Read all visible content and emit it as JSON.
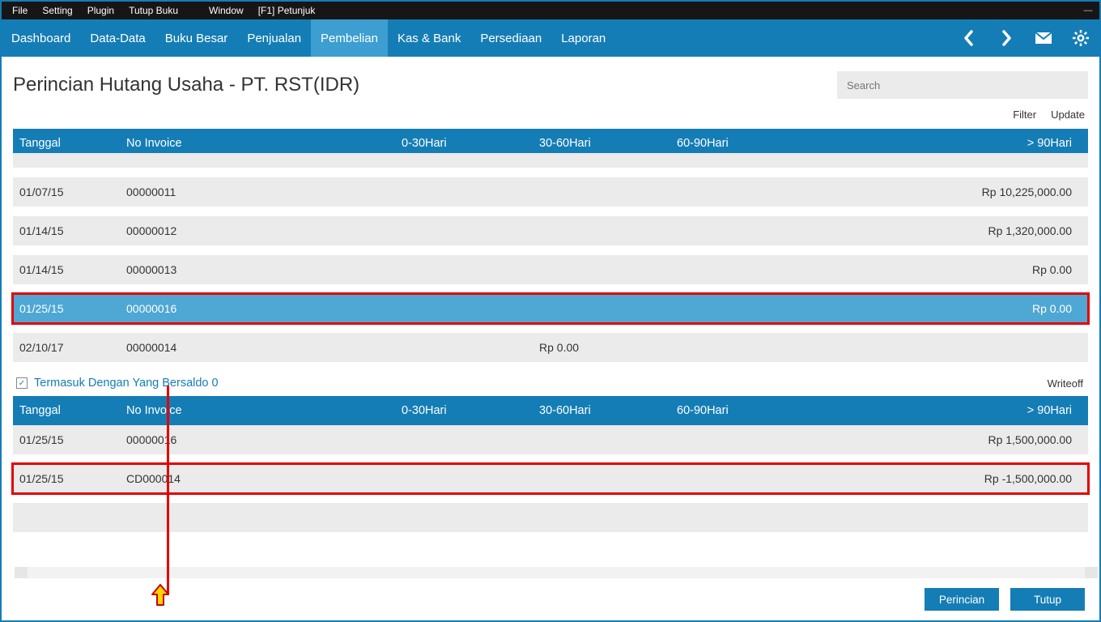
{
  "menubar": [
    "File",
    "Setting",
    "Plugin",
    "Tutup Buku",
    "",
    "Window",
    "[F1] Petunjuk"
  ],
  "nav": {
    "items": [
      "Dashboard",
      "Data-Data",
      "Buku Besar",
      "Penjualan",
      "Pembelian",
      "Kas & Bank",
      "Persediaan",
      "Laporan"
    ],
    "active_index": 4
  },
  "page": {
    "title": "Perincian Hutang Usaha - PT. RST(IDR)",
    "search_placeholder": "Search"
  },
  "toolbar": {
    "filter": "Filter",
    "update": "Update"
  },
  "columns": {
    "tanggal": "Tanggal",
    "no_invoice": "No Invoice",
    "c0_30": "0-30Hari",
    "c30_60": "30-60Hari",
    "c60_90": "60-90Hari",
    "c90p": "> 90Hari"
  },
  "main_rows": [
    {
      "tanggal": "01/07/15",
      "invoice": "00000011",
      "a": "",
      "b": "",
      "c": "",
      "d": "Rp 10,225,000.00"
    },
    {
      "tanggal": "01/14/15",
      "invoice": "00000012",
      "a": "",
      "b": "",
      "c": "",
      "d": "Rp 1,320,000.00"
    },
    {
      "tanggal": "01/14/15",
      "invoice": "00000013",
      "a": "",
      "b": "",
      "c": "",
      "d": "Rp 0.00"
    },
    {
      "tanggal": "01/25/15",
      "invoice": "00000016",
      "a": "",
      "b": "",
      "c": "",
      "d": "Rp 0.00",
      "selected": true,
      "highlight": true
    },
    {
      "tanggal": "02/10/17",
      "invoice": "00000014",
      "a": "",
      "b": "Rp 0.00",
      "c": "",
      "d": ""
    }
  ],
  "checkbox_label": "Termasuk Dengan Yang Bersaldo 0",
  "writeoff_label": "Writeoff",
  "detail_rows": [
    {
      "tanggal": "01/25/15",
      "invoice": "00000016",
      "a": "",
      "b": "",
      "c": "",
      "d": "Rp 1,500,000.00"
    },
    {
      "tanggal": "01/25/15",
      "invoice": "CD000014",
      "a": "",
      "b": "",
      "c": "",
      "d": "Rp -1,500,000.00",
      "highlight": true
    }
  ],
  "footer": {
    "perincian": "Perincian",
    "tutup": "Tutup"
  }
}
